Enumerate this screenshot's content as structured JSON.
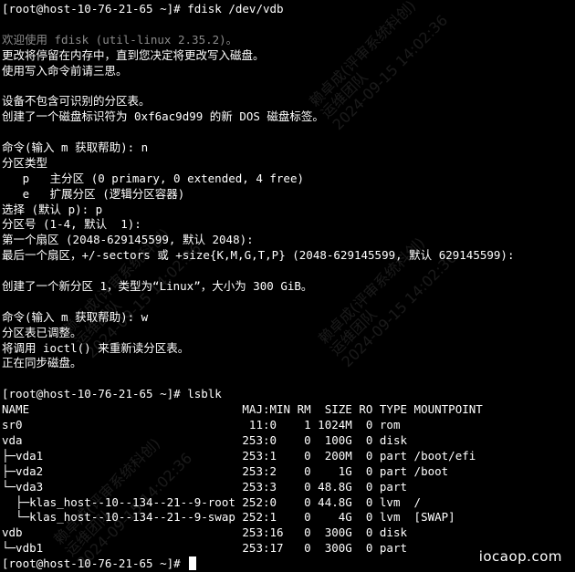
{
  "terminal": {
    "lines": [
      {
        "text": "[root@host-10-76-21-65 ~]# fdisk /dev/vdb",
        "style": "normal"
      },
      {
        "text": "",
        "style": "normal"
      },
      {
        "text": "欢迎使用 fdisk (util-linux 2.35.2)。",
        "style": "greeting"
      },
      {
        "text": "更改将停留在内存中，直到您决定将更改写入磁盘。",
        "style": "normal"
      },
      {
        "text": "使用写入命令前请三思。",
        "style": "normal"
      },
      {
        "text": "",
        "style": "normal"
      },
      {
        "text": "设备不包含可识别的分区表。",
        "style": "normal"
      },
      {
        "text": "创建了一个磁盘标识符为 0xf6ac9d99 的新 DOS 磁盘标签。",
        "style": "normal"
      },
      {
        "text": "",
        "style": "normal"
      },
      {
        "text": "命令(输入 m 获取帮助): n",
        "style": "normal"
      },
      {
        "text": "分区类型",
        "style": "normal"
      },
      {
        "text": "   p   主分区 (0 primary, 0 extended, 4 free)",
        "style": "normal"
      },
      {
        "text": "   e   扩展分区 (逻辑分区容器)",
        "style": "normal"
      },
      {
        "text": "选择 (默认 p): p",
        "style": "normal"
      },
      {
        "text": "分区号 (1-4, 默认  1):",
        "style": "normal"
      },
      {
        "text": "第一个扇区 (2048-629145599, 默认 2048):",
        "style": "normal"
      },
      {
        "text": "最后一个扇区，+/-sectors 或 +size{K,M,G,T,P} (2048-629145599, 默认 629145599):",
        "style": "normal"
      },
      {
        "text": "",
        "style": "normal"
      },
      {
        "text": "创建了一个新分区 1，类型为“Linux”，大小为 300 GiB。",
        "style": "normal"
      },
      {
        "text": "",
        "style": "normal"
      },
      {
        "text": "命令(输入 m 获取帮助): w",
        "style": "normal"
      },
      {
        "text": "分区表已调整。",
        "style": "normal"
      },
      {
        "text": "将调用 ioctl() 来重新读分区表。",
        "style": "normal"
      },
      {
        "text": "正在同步磁盘。",
        "style": "normal"
      },
      {
        "text": "",
        "style": "normal"
      },
      {
        "text": "[root@host-10-76-21-65 ~]# lsblk",
        "style": "normal"
      },
      {
        "text": "NAME                               MAJ:MIN RM  SIZE RO TYPE MOUNTPOINT",
        "style": "normal"
      },
      {
        "text": "sr0                                 11:0    1 1024M  0 rom",
        "style": "normal"
      },
      {
        "text": "vda                                253:0    0  100G  0 disk",
        "style": "normal"
      },
      {
        "text": "├─vda1                             253:1    0  200M  0 part /boot/efi",
        "style": "normal"
      },
      {
        "text": "├─vda2                             253:2    0    1G  0 part /boot",
        "style": "normal"
      },
      {
        "text": "└─vda3                             253:3    0 48.8G  0 part",
        "style": "normal"
      },
      {
        "text": "  ├─klas_host--10--134--21--9-root 252:0    0 44.8G  0 lvm  /",
        "style": "normal"
      },
      {
        "text": "  └─klas_host--10--134--21--9-swap 252:1    0    4G  0 lvm  [SWAP]",
        "style": "normal"
      },
      {
        "text": "vdb                                253:16   0  300G  0 disk",
        "style": "normal"
      },
      {
        "text": "└─vdb1                             253:17   0  300G  0 part",
        "style": "normal"
      }
    ],
    "prompt": "[root@host-10-76-21-65 ~]# "
  },
  "watermark": {
    "site": "iocaop.com",
    "overlay_lines": [
      "赖卓成(评审系统科创)",
      "运维团队",
      "2024-09-15 14:02:36"
    ]
  },
  "colors": {
    "background": "#000000",
    "foreground": "#ffffff",
    "greeting": "#8a8a8a"
  }
}
